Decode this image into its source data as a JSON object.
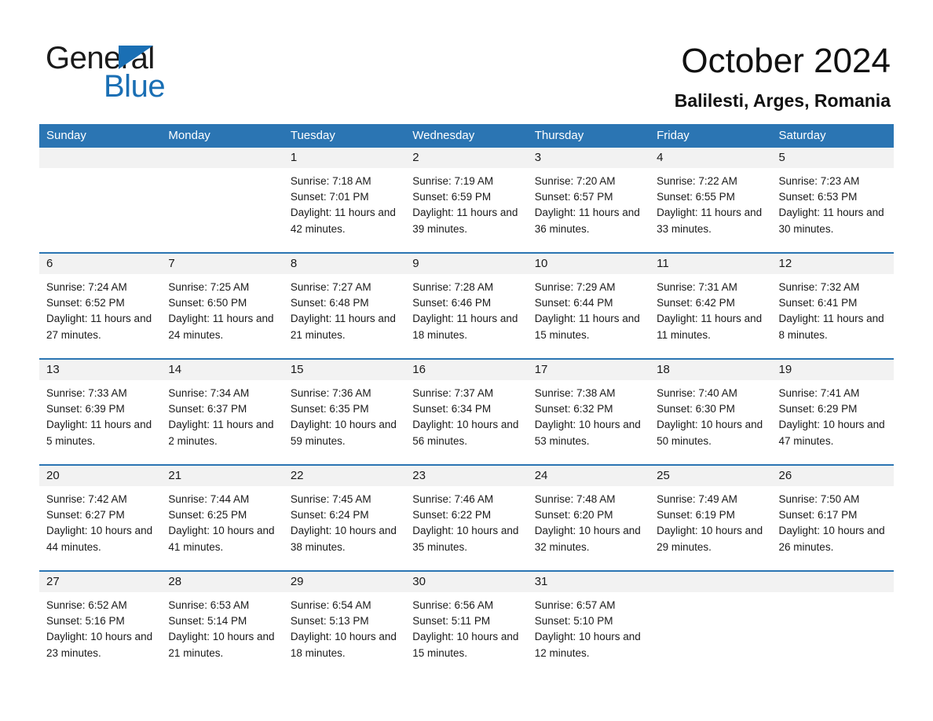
{
  "brand": {
    "name_part1": "General",
    "name_part2": "Blue",
    "logo_icon": "triangle-icon",
    "colors": {
      "blue": "#1a6fb4",
      "header_blue": "#2b75b3",
      "strip_gray": "#f2f2f2"
    }
  },
  "header": {
    "title": "October 2024",
    "location": "Balilesti, Arges, Romania"
  },
  "weekdays": [
    "Sunday",
    "Monday",
    "Tuesday",
    "Wednesday",
    "Thursday",
    "Friday",
    "Saturday"
  ],
  "weeks": [
    [
      {
        "day": "",
        "sunrise": "",
        "sunset": "",
        "daylight": "",
        "empty": true
      },
      {
        "day": "",
        "sunrise": "",
        "sunset": "",
        "daylight": "",
        "empty": true
      },
      {
        "day": "1",
        "sunrise": "Sunrise: 7:18 AM",
        "sunset": "Sunset: 7:01 PM",
        "daylight": "Daylight: 11 hours and 42 minutes."
      },
      {
        "day": "2",
        "sunrise": "Sunrise: 7:19 AM",
        "sunset": "Sunset: 6:59 PM",
        "daylight": "Daylight: 11 hours and 39 minutes."
      },
      {
        "day": "3",
        "sunrise": "Sunrise: 7:20 AM",
        "sunset": "Sunset: 6:57 PM",
        "daylight": "Daylight: 11 hours and 36 minutes."
      },
      {
        "day": "4",
        "sunrise": "Sunrise: 7:22 AM",
        "sunset": "Sunset: 6:55 PM",
        "daylight": "Daylight: 11 hours and 33 minutes."
      },
      {
        "day": "5",
        "sunrise": "Sunrise: 7:23 AM",
        "sunset": "Sunset: 6:53 PM",
        "daylight": "Daylight: 11 hours and 30 minutes."
      }
    ],
    [
      {
        "day": "6",
        "sunrise": "Sunrise: 7:24 AM",
        "sunset": "Sunset: 6:52 PM",
        "daylight": "Daylight: 11 hours and 27 minutes."
      },
      {
        "day": "7",
        "sunrise": "Sunrise: 7:25 AM",
        "sunset": "Sunset: 6:50 PM",
        "daylight": "Daylight: 11 hours and 24 minutes."
      },
      {
        "day": "8",
        "sunrise": "Sunrise: 7:27 AM",
        "sunset": "Sunset: 6:48 PM",
        "daylight": "Daylight: 11 hours and 21 minutes."
      },
      {
        "day": "9",
        "sunrise": "Sunrise: 7:28 AM",
        "sunset": "Sunset: 6:46 PM",
        "daylight": "Daylight: 11 hours and 18 minutes."
      },
      {
        "day": "10",
        "sunrise": "Sunrise: 7:29 AM",
        "sunset": "Sunset: 6:44 PM",
        "daylight": "Daylight: 11 hours and 15 minutes."
      },
      {
        "day": "11",
        "sunrise": "Sunrise: 7:31 AM",
        "sunset": "Sunset: 6:42 PM",
        "daylight": "Daylight: 11 hours and 11 minutes."
      },
      {
        "day": "12",
        "sunrise": "Sunrise: 7:32 AM",
        "sunset": "Sunset: 6:41 PM",
        "daylight": "Daylight: 11 hours and 8 minutes."
      }
    ],
    [
      {
        "day": "13",
        "sunrise": "Sunrise: 7:33 AM",
        "sunset": "Sunset: 6:39 PM",
        "daylight": "Daylight: 11 hours and 5 minutes."
      },
      {
        "day": "14",
        "sunrise": "Sunrise: 7:34 AM",
        "sunset": "Sunset: 6:37 PM",
        "daylight": "Daylight: 11 hours and 2 minutes."
      },
      {
        "day": "15",
        "sunrise": "Sunrise: 7:36 AM",
        "sunset": "Sunset: 6:35 PM",
        "daylight": "Daylight: 10 hours and 59 minutes."
      },
      {
        "day": "16",
        "sunrise": "Sunrise: 7:37 AM",
        "sunset": "Sunset: 6:34 PM",
        "daylight": "Daylight: 10 hours and 56 minutes."
      },
      {
        "day": "17",
        "sunrise": "Sunrise: 7:38 AM",
        "sunset": "Sunset: 6:32 PM",
        "daylight": "Daylight: 10 hours and 53 minutes."
      },
      {
        "day": "18",
        "sunrise": "Sunrise: 7:40 AM",
        "sunset": "Sunset: 6:30 PM",
        "daylight": "Daylight: 10 hours and 50 minutes."
      },
      {
        "day": "19",
        "sunrise": "Sunrise: 7:41 AM",
        "sunset": "Sunset: 6:29 PM",
        "daylight": "Daylight: 10 hours and 47 minutes."
      }
    ],
    [
      {
        "day": "20",
        "sunrise": "Sunrise: 7:42 AM",
        "sunset": "Sunset: 6:27 PM",
        "daylight": "Daylight: 10 hours and 44 minutes."
      },
      {
        "day": "21",
        "sunrise": "Sunrise: 7:44 AM",
        "sunset": "Sunset: 6:25 PM",
        "daylight": "Daylight: 10 hours and 41 minutes."
      },
      {
        "day": "22",
        "sunrise": "Sunrise: 7:45 AM",
        "sunset": "Sunset: 6:24 PM",
        "daylight": "Daylight: 10 hours and 38 minutes."
      },
      {
        "day": "23",
        "sunrise": "Sunrise: 7:46 AM",
        "sunset": "Sunset: 6:22 PM",
        "daylight": "Daylight: 10 hours and 35 minutes."
      },
      {
        "day": "24",
        "sunrise": "Sunrise: 7:48 AM",
        "sunset": "Sunset: 6:20 PM",
        "daylight": "Daylight: 10 hours and 32 minutes."
      },
      {
        "day": "25",
        "sunrise": "Sunrise: 7:49 AM",
        "sunset": "Sunset: 6:19 PM",
        "daylight": "Daylight: 10 hours and 29 minutes."
      },
      {
        "day": "26",
        "sunrise": "Sunrise: 7:50 AM",
        "sunset": "Sunset: 6:17 PM",
        "daylight": "Daylight: 10 hours and 26 minutes."
      }
    ],
    [
      {
        "day": "27",
        "sunrise": "Sunrise: 6:52 AM",
        "sunset": "Sunset: 5:16 PM",
        "daylight": "Daylight: 10 hours and 23 minutes."
      },
      {
        "day": "28",
        "sunrise": "Sunrise: 6:53 AM",
        "sunset": "Sunset: 5:14 PM",
        "daylight": "Daylight: 10 hours and 21 minutes."
      },
      {
        "day": "29",
        "sunrise": "Sunrise: 6:54 AM",
        "sunset": "Sunset: 5:13 PM",
        "daylight": "Daylight: 10 hours and 18 minutes."
      },
      {
        "day": "30",
        "sunrise": "Sunrise: 6:56 AM",
        "sunset": "Sunset: 5:11 PM",
        "daylight": "Daylight: 10 hours and 15 minutes."
      },
      {
        "day": "31",
        "sunrise": "Sunrise: 6:57 AM",
        "sunset": "Sunset: 5:10 PM",
        "daylight": "Daylight: 10 hours and 12 minutes."
      },
      {
        "day": "",
        "sunrise": "",
        "sunset": "",
        "daylight": "",
        "empty": true
      },
      {
        "day": "",
        "sunrise": "",
        "sunset": "",
        "daylight": "",
        "empty": true
      }
    ]
  ]
}
